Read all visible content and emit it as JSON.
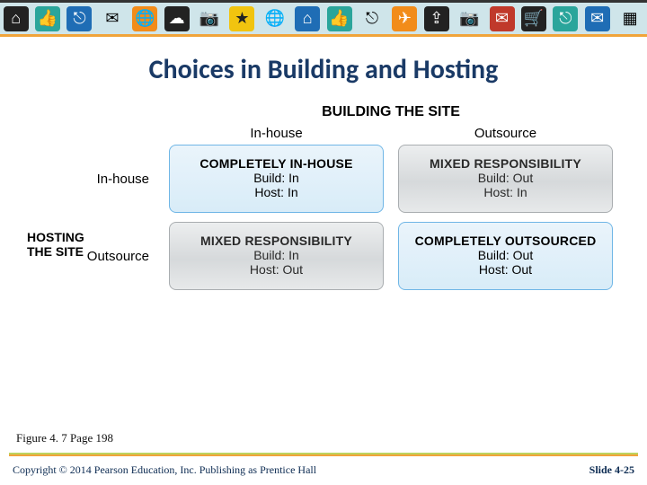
{
  "title": "Choices in Building and Hosting",
  "building_header": "BUILDING THE SITE",
  "col_labels": {
    "inhouse": "In-house",
    "outsource": "Outsource"
  },
  "hosting_header": "HOSTING THE SITE",
  "row_labels": {
    "inhouse": "In-house",
    "outsource": "Outsource"
  },
  "cells": {
    "in_in": {
      "head": "COMPLETELY IN-HOUSE",
      "l1": "Build: In",
      "l2": "Host: In"
    },
    "in_out": {
      "head": "MIXED RESPONSIBILITY",
      "l1": "Build: Out",
      "l2": "Host: In"
    },
    "out_in": {
      "head": "MIXED RESPONSIBILITY",
      "l1": "Build: In",
      "l2": "Host: Out"
    },
    "out_out": {
      "head": "COMPLETELY OUTSOURCED",
      "l1": "Build: Out",
      "l2": "Host: Out"
    }
  },
  "caption": "Figure 4. 7 Page 198",
  "footer": {
    "left": "Copyright © 2014 Pearson Education, Inc. Publishing as Prentice Hall",
    "right": "Slide 4-25"
  },
  "chart_data": {
    "type": "table",
    "title": "Choices in Building and Hosting",
    "row_dimension": "HOSTING THE SITE",
    "col_dimension": "BUILDING THE SITE",
    "rows": [
      "In-house",
      "Outsource"
    ],
    "cols": [
      "In-house",
      "Outsource"
    ],
    "cells": [
      {
        "row": "In-house",
        "col": "In-house",
        "label": "COMPLETELY IN-HOUSE",
        "build": "In",
        "host": "In",
        "highlight": true
      },
      {
        "row": "In-house",
        "col": "Outsource",
        "label": "MIXED RESPONSIBILITY",
        "build": "Out",
        "host": "In",
        "highlight": false
      },
      {
        "row": "Outsource",
        "col": "In-house",
        "label": "MIXED RESPONSIBILITY",
        "build": "In",
        "host": "Out",
        "highlight": false
      },
      {
        "row": "Outsource",
        "col": "Outsource",
        "label": "COMPLETELY OUTSOURCED",
        "build": "Out",
        "host": "Out",
        "highlight": true
      }
    ]
  }
}
